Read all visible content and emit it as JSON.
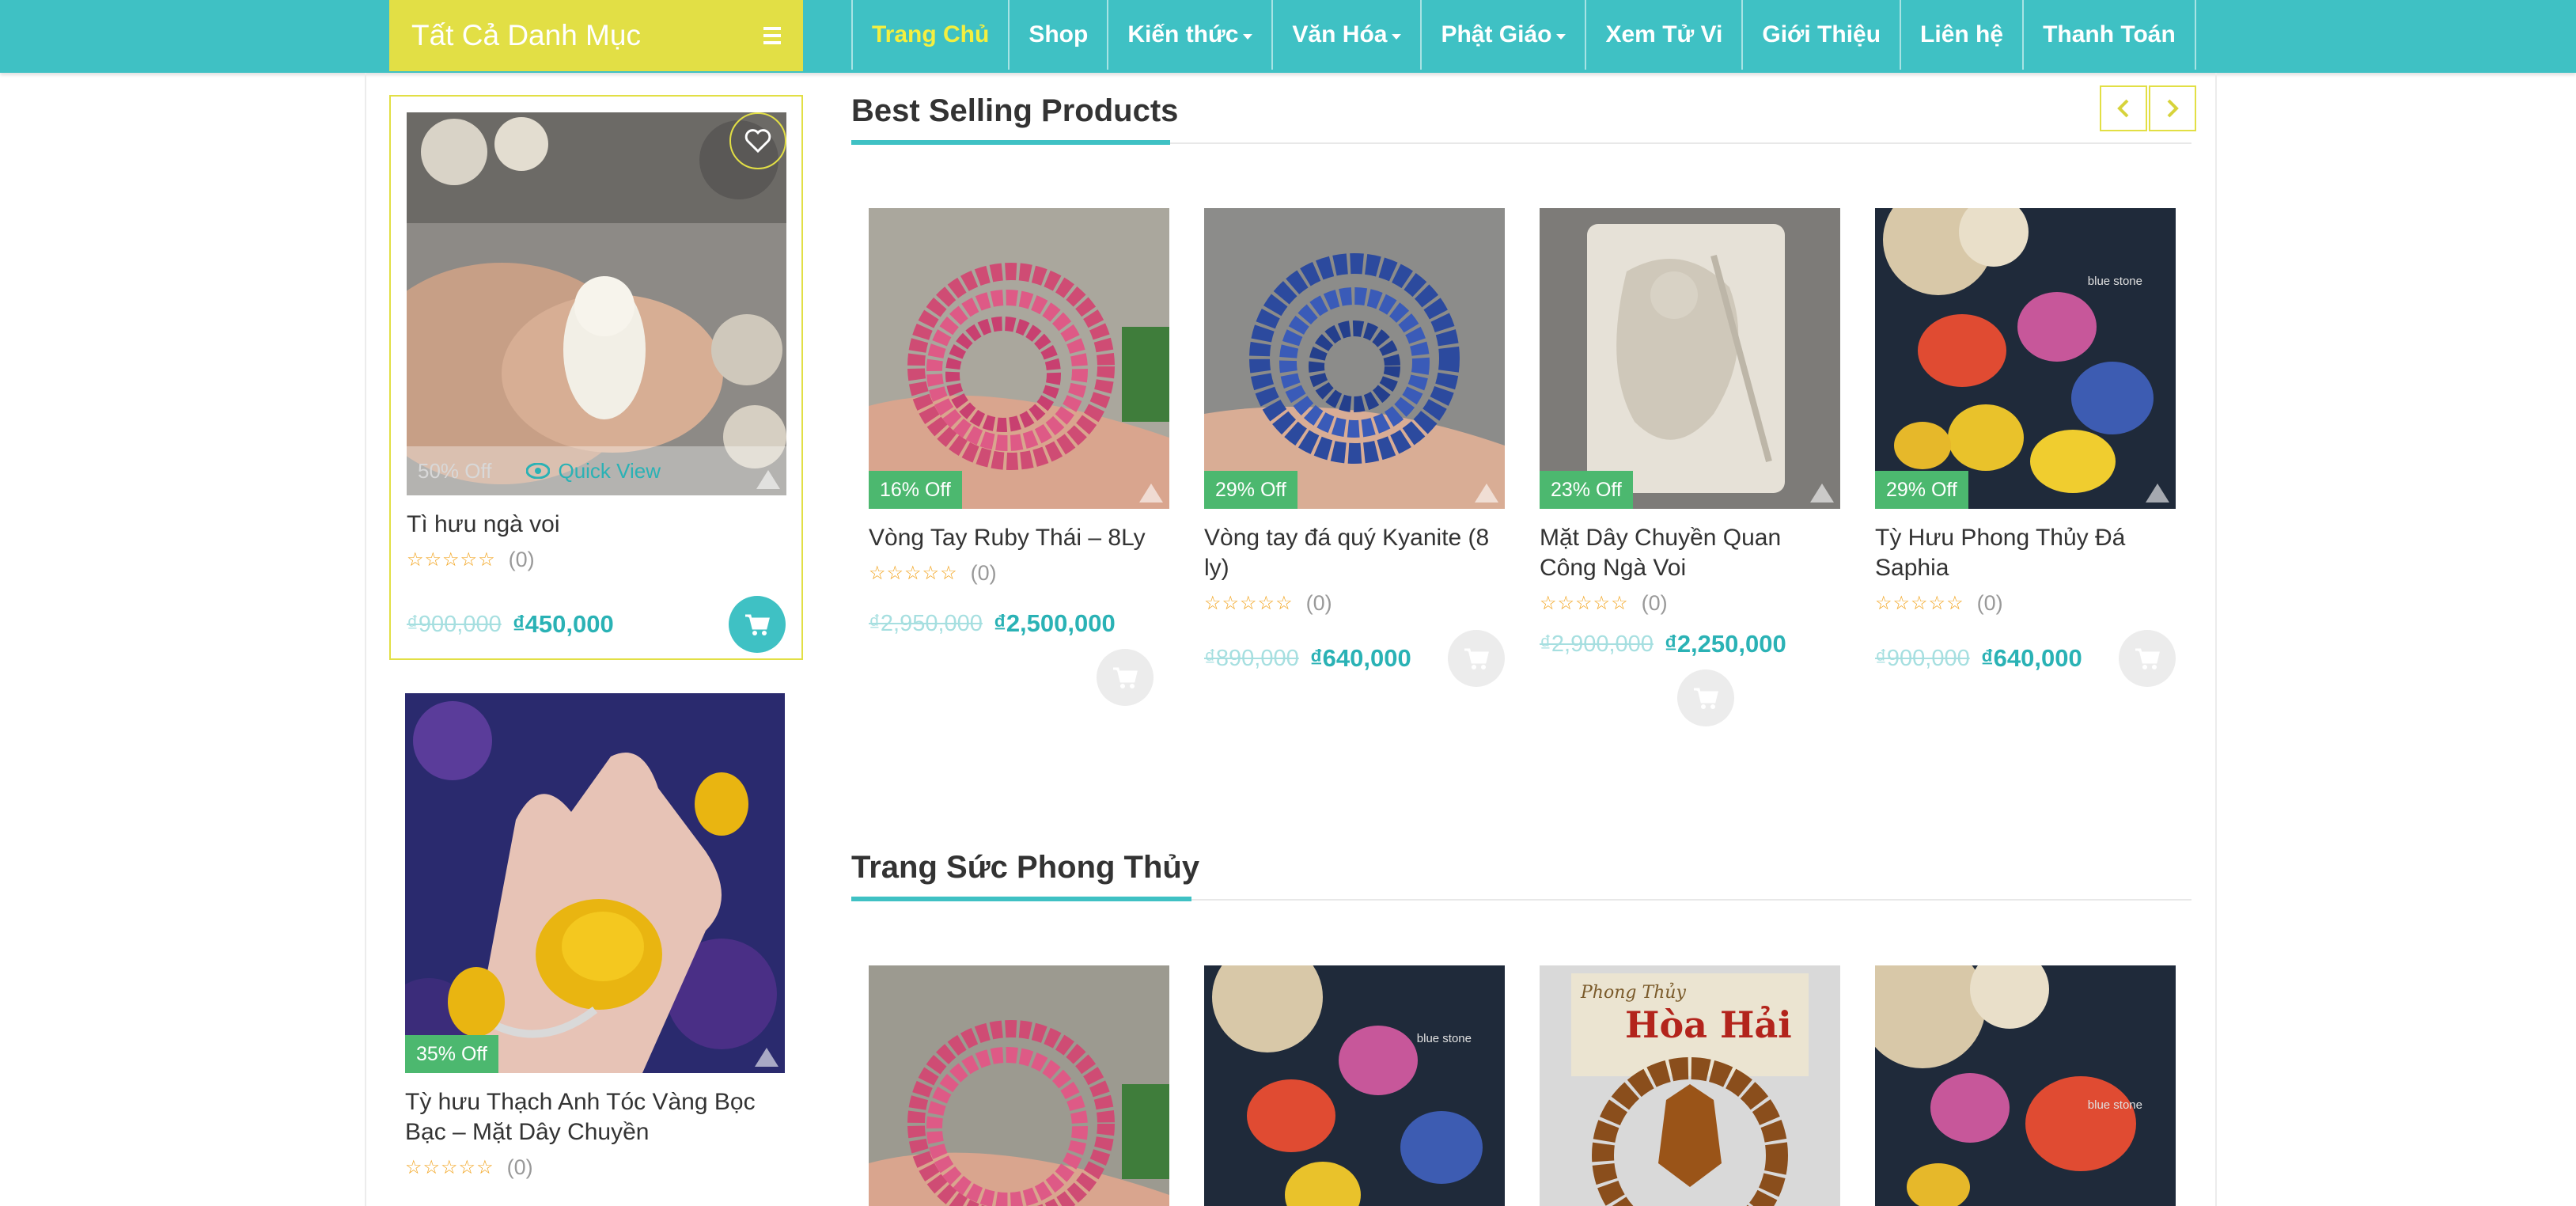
{
  "nav": {
    "category_title": "Tất Cả Danh Mục",
    "items": [
      {
        "label": "Trang Chủ",
        "active": true,
        "dropdown": false
      },
      {
        "label": "Shop",
        "active": false,
        "dropdown": false
      },
      {
        "label": "Kiến thức",
        "active": false,
        "dropdown": true
      },
      {
        "label": "Văn Hóa",
        "active": false,
        "dropdown": true
      },
      {
        "label": "Phật Giáo",
        "active": false,
        "dropdown": true
      },
      {
        "label": "Xem Tử Vi",
        "active": false,
        "dropdown": false
      },
      {
        "label": "Giới Thiệu",
        "active": false,
        "dropdown": false
      },
      {
        "label": "Liên hệ",
        "active": false,
        "dropdown": false
      },
      {
        "label": "Thanh Toán",
        "active": false,
        "dropdown": false
      }
    ]
  },
  "sidebar": {
    "products": [
      {
        "name": "Tì hưu ngà voi",
        "badge": "50% Off",
        "quick_view": "Quick View",
        "rating_count": "(0)",
        "old_price": "₫900,000",
        "new_price": "₫450,000"
      },
      {
        "name": "Tỳ hưu Thạch Anh Tóc Vàng Bọc Bạc – Mặt Dây Chuyền",
        "badge": "35% Off",
        "rating_count": "(0)"
      }
    ]
  },
  "best_selling": {
    "title": "Best Selling Products",
    "products": [
      {
        "name": "Vòng Tay Ruby Thái – 8Ly",
        "badge": "16% Off",
        "rating_count": "(0)",
        "old_price": "₫2,950,000",
        "new_price": "₫2,500,000"
      },
      {
        "name": "Vòng tay đá quý Kyanite (8 ly)",
        "badge": "29% Off",
        "rating_count": "(0)",
        "old_price": "₫890,000",
        "new_price": "₫640,000"
      },
      {
        "name": "Mặt Dây Chuyền Quan Công Ngà Voi",
        "badge": "23% Off",
        "rating_count": "(0)",
        "old_price": "₫2,900,000",
        "new_price": "₫2,250,000"
      },
      {
        "name": "Tỳ Hưu Phong Thủy Đá Saphia",
        "badge": "29% Off",
        "rating_count": "(0)",
        "old_price": "₫900,000",
        "new_price": "₫640,000"
      }
    ]
  },
  "jewelry": {
    "title": "Trang Sức Phong Thủy",
    "image_text": [
      "Phong Thủy",
      "Hòa Hải"
    ]
  },
  "watermark": "blue stone",
  "stars": "☆☆☆☆☆",
  "colors": {
    "teal": "#3fc1c4",
    "yellow": "#e2df45",
    "badge_green": "#4cb86f"
  }
}
